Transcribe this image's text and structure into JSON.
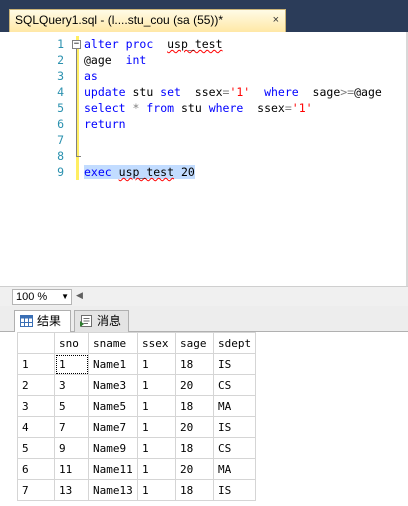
{
  "tab": {
    "title": "SQLQuery1.sql - (l....stu_cou (sa (55))*",
    "close": "×"
  },
  "editor": {
    "lines": [
      {
        "n": "1",
        "tokens": [
          {
            "t": "alter",
            "c": "kw"
          },
          {
            "t": " ",
            "c": "id"
          },
          {
            "t": "proc",
            "c": "kw"
          },
          {
            "t": "  ",
            "c": "id"
          },
          {
            "t": "usp_test",
            "c": "id squig"
          }
        ]
      },
      {
        "n": "2",
        "tokens": [
          {
            "t": "@age",
            "c": "id"
          },
          {
            "t": "  ",
            "c": "id"
          },
          {
            "t": "int",
            "c": "kw"
          }
        ]
      },
      {
        "n": "3",
        "tokens": [
          {
            "t": "as",
            "c": "kw"
          }
        ]
      },
      {
        "n": "4",
        "tokens": [
          {
            "t": "update",
            "c": "kw"
          },
          {
            "t": " stu ",
            "c": "id"
          },
          {
            "t": "set",
            "c": "kw"
          },
          {
            "t": "  ssex",
            "c": "id"
          },
          {
            "t": "=",
            "c": "op"
          },
          {
            "t": "'1'",
            "c": "str"
          },
          {
            "t": "  ",
            "c": "id"
          },
          {
            "t": "where",
            "c": "kw"
          },
          {
            "t": "  sage",
            "c": "id"
          },
          {
            "t": ">=",
            "c": "op"
          },
          {
            "t": "@age",
            "c": "id"
          }
        ]
      },
      {
        "n": "5",
        "tokens": [
          {
            "t": "select",
            "c": "kw"
          },
          {
            "t": " ",
            "c": "id"
          },
          {
            "t": "*",
            "c": "op"
          },
          {
            "t": " ",
            "c": "id"
          },
          {
            "t": "from",
            "c": "kw"
          },
          {
            "t": " stu ",
            "c": "id"
          },
          {
            "t": "where",
            "c": "kw"
          },
          {
            "t": "  ssex",
            "c": "id"
          },
          {
            "t": "=",
            "c": "op"
          },
          {
            "t": "'1'",
            "c": "str"
          }
        ]
      },
      {
        "n": "6",
        "tokens": [
          {
            "t": "return",
            "c": "kw"
          }
        ]
      },
      {
        "n": "7",
        "tokens": []
      },
      {
        "n": "8",
        "tokens": []
      },
      {
        "n": "9",
        "tokens": [
          {
            "t": "exec",
            "c": "kw sel"
          },
          {
            "t": " ",
            "c": "id sel"
          },
          {
            "t": "usp_test",
            "c": "id squig sel"
          },
          {
            "t": " 20",
            "c": "id sel"
          }
        ]
      }
    ]
  },
  "zoom": {
    "value": "100 %"
  },
  "results_tabs": {
    "results": "结果",
    "messages": "消息"
  },
  "grid": {
    "columns": [
      "sno",
      "sname",
      "ssex",
      "sage",
      "sdept"
    ],
    "rows": [
      {
        "n": "1",
        "cells": [
          "1",
          "Name1",
          "1",
          "18",
          "IS"
        ]
      },
      {
        "n": "2",
        "cells": [
          "3",
          "Name3",
          "1",
          "20",
          "CS"
        ]
      },
      {
        "n": "3",
        "cells": [
          "5",
          "Name5",
          "1",
          "18",
          "MA"
        ]
      },
      {
        "n": "4",
        "cells": [
          "7",
          "Name7",
          "1",
          "20",
          "IS"
        ]
      },
      {
        "n": "5",
        "cells": [
          "9",
          "Name9",
          "1",
          "18",
          "CS"
        ]
      },
      {
        "n": "6",
        "cells": [
          "11",
          "Name11",
          "1",
          "20",
          "MA"
        ]
      },
      {
        "n": "7",
        "cells": [
          "13",
          "Name13",
          "1",
          "18",
          "IS"
        ]
      }
    ]
  }
}
